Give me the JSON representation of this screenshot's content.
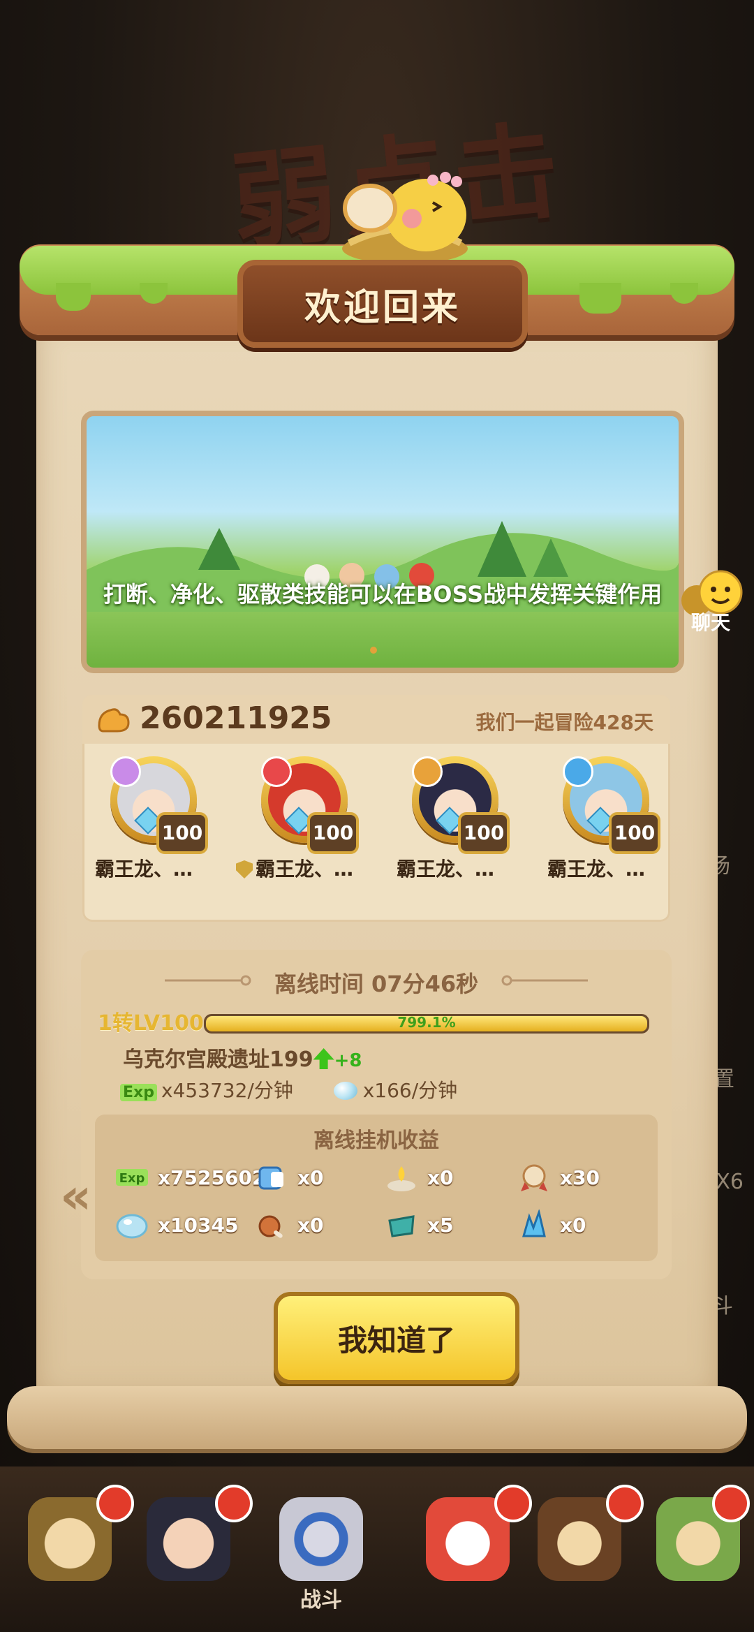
{
  "dialog": {
    "title": "欢迎回来",
    "banner_tip": "打断、净化、驱散类技能可以在BOSS战中发挥关键作用",
    "power_value": "260211925",
    "adventure_days": "我们一起冒险428天",
    "heroes": [
      {
        "name": "霸王龙、…",
        "level": "100",
        "element_color": "#c98be8",
        "hair_color": "#d7d7dc"
      },
      {
        "name": "霸王龙、…",
        "level": "100",
        "element_color": "#e8484a",
        "hair_color": "#d53a2c",
        "has_shield": true
      },
      {
        "name": "霸王龙、…",
        "level": "100",
        "element_color": "#e8a23a",
        "hair_color": "#2b2a45"
      },
      {
        "name": "霸王龙、…",
        "level": "100",
        "element_color": "#4aa9e8",
        "hair_color": "#8ec6e6"
      }
    ],
    "offline": {
      "title": "离线时间 07分46秒",
      "level_label": "1转LV100",
      "exp_percent_text": "799.1%",
      "stage_name": "乌克尔宫殿遗址199",
      "stage_bonus": "+8",
      "exp_tag": "Exp",
      "exp_rate": "x453732/分钟",
      "crystal_rate": "x166/分钟",
      "rewards_title": "离线挂机收益",
      "rewards": [
        {
          "icon": "exp-icon",
          "value": "x7525602"
        },
        {
          "icon": "potion-icon",
          "value": "x0"
        },
        {
          "icon": "candle-icon",
          "value": "x0"
        },
        {
          "icon": "medal-icon",
          "value": "x30"
        },
        {
          "icon": "crystal-icon",
          "value": "x10345"
        },
        {
          "icon": "meat-icon",
          "value": "x0"
        },
        {
          "icon": "teal-gem-icon",
          "value": "x5"
        },
        {
          "icon": "blue-shard-icon",
          "value": "x0"
        }
      ]
    },
    "ok_button": "我知道了"
  },
  "background": {
    "title_text": "弱点击破",
    "edge_texts": [
      "场",
      "置",
      "-X6",
      "斗"
    ]
  },
  "chat": {
    "label": "聊天"
  },
  "bottom_nav": {
    "items": [
      {
        "label": "",
        "has_badge": true
      },
      {
        "label": "",
        "has_badge": true
      },
      {
        "label": "战斗",
        "has_badge": false
      },
      {
        "label": "",
        "has_badge": true
      },
      {
        "label": "",
        "has_badge": true
      },
      {
        "label": "",
        "has_badge": true
      }
    ]
  },
  "colors": {
    "accent_yellow": "#f4c52a",
    "scroll_paper": "#e4cfad",
    "grass": "#8cc43c",
    "exp_green": "#3f9f1c"
  }
}
